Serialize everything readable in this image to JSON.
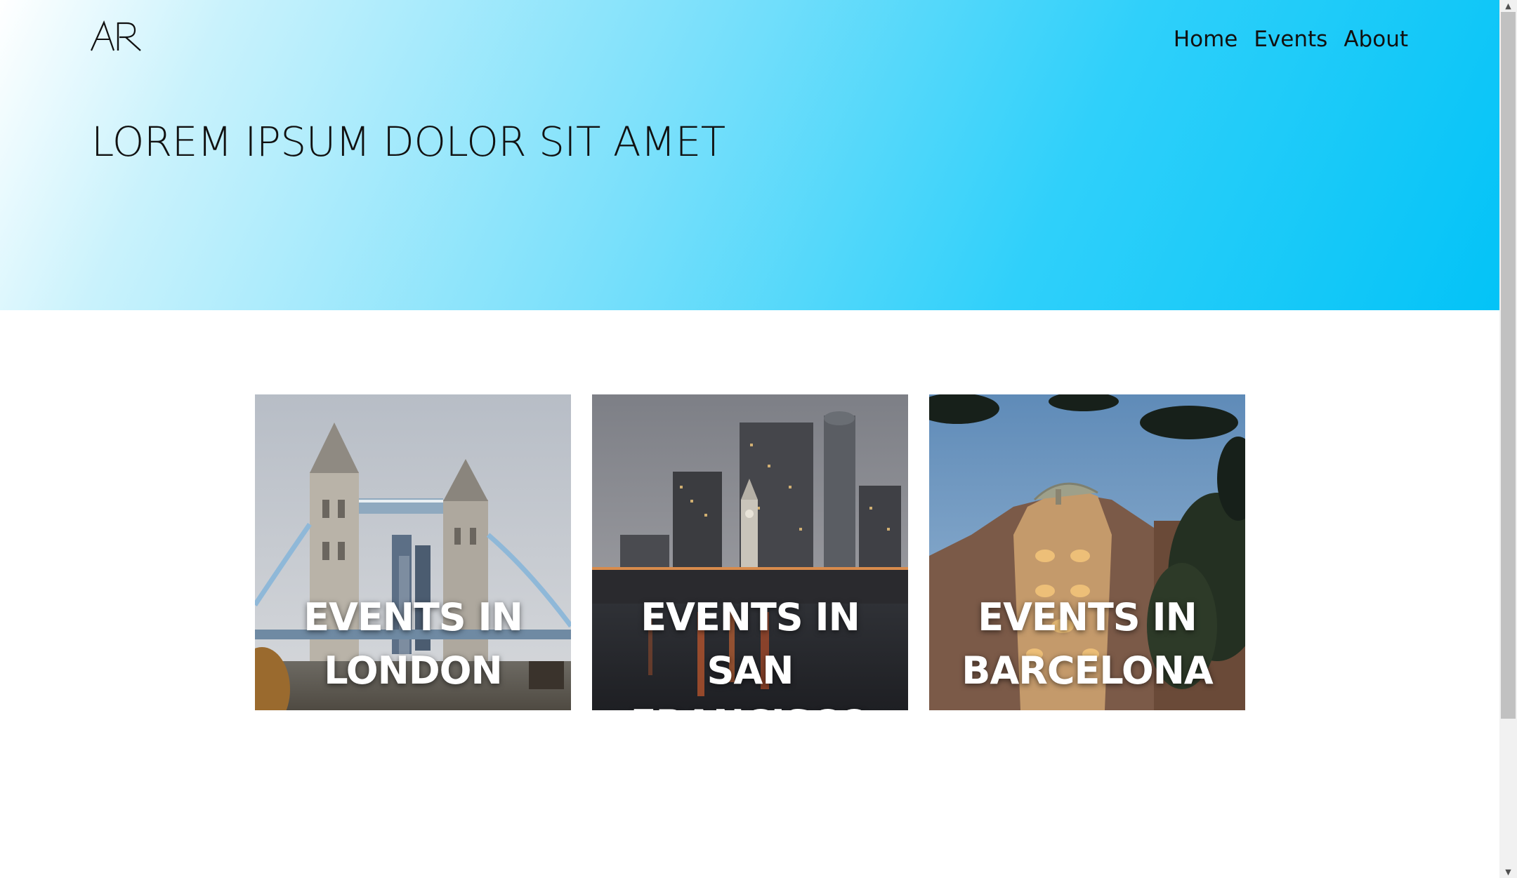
{
  "header": {
    "logo_text": "AR",
    "nav": [
      {
        "label": "Home"
      },
      {
        "label": "Events"
      },
      {
        "label": "About"
      }
    ]
  },
  "hero": {
    "title": "LOREM IPSUM DOLOR SIT AMET"
  },
  "cards": [
    {
      "title": "EVENTS IN LONDON",
      "image": "tower-bridge-london-photo"
    },
    {
      "title": "EVENTS IN SAN FRANCISCO",
      "image": "san-francisco-ferry-building-skyline-photo"
    },
    {
      "title": "EVENTS IN BARCELONA",
      "image": "casa-batllo-barcelona-photo"
    }
  ],
  "scrollbar": {
    "up_icon": "chevron-up-icon",
    "down_icon": "chevron-down-icon"
  }
}
